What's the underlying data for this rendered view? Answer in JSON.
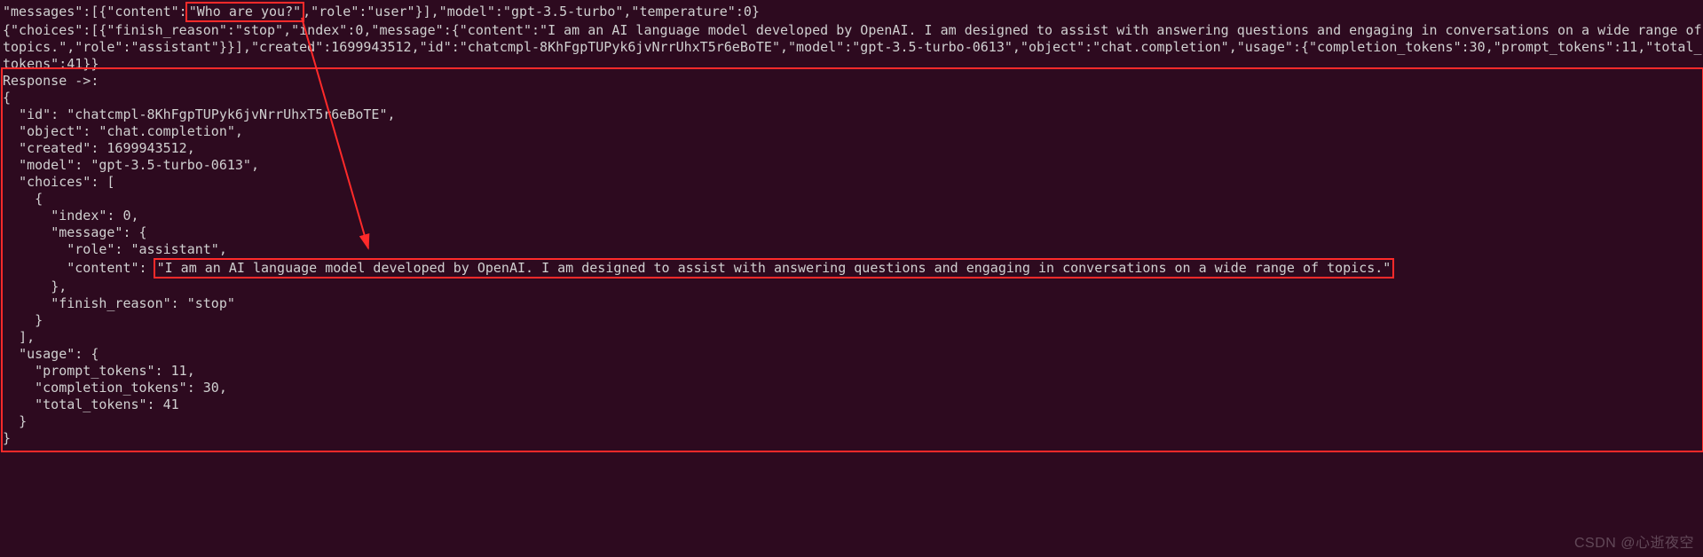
{
  "request_prefix": "\"messages\":[{\"content\":",
  "request_highlight": "\"Who are you?\"",
  "request_suffix": ",\"role\":\"user\"}],\"model\":\"gpt-3.5-turbo\",\"temperature\":0}",
  "raw_choice_line": "{\"choices\":[{\"finish_reason\":\"stop\",\"index\":0,\"message\":{\"content\":\"I am an AI language model developed by OpenAI. I am designed to assist with answering questions and engaging in conversations on a wide range of topics.\",\"role\":\"assistant\"}}],\"created\":1699943512,\"id\":\"chatcmpl-8KhFgpTUPyk6jvNrrUhxT5r6eBoTE\",\"model\":\"gpt-3.5-turbo-0613\",\"object\":\"chat.completion\",\"usage\":{\"completion_tokens\":30,\"prompt_tokens\":11,\"total_tokens\":41}}",
  "response_header": "Response ->:",
  "pretty_open": "{",
  "pretty_id": "  \"id\": \"chatcmpl-8KhFgpTUPyk6jvNrrUhxT5r6eBoTE\",",
  "pretty_object": "  \"object\": \"chat.completion\",",
  "pretty_created": "  \"created\": 1699943512,",
  "pretty_model": "  \"model\": \"gpt-3.5-turbo-0613\",",
  "pretty_choices_k": "  \"choices\": [",
  "pretty_choice_o": "    {",
  "pretty_index": "      \"index\": 0,",
  "pretty_message_k": "      \"message\": {",
  "pretty_role": "        \"role\": \"assistant\",",
  "pretty_content_prefix": "        \"content\": ",
  "pretty_content_value": "\"I am an AI language model developed by OpenAI. I am designed to assist with answering questions and engaging in conversations on a wide range of topics.\"",
  "pretty_message_c": "      },",
  "pretty_finish": "      \"finish_reason\": \"stop\"",
  "pretty_choice_c": "    }",
  "pretty_choices_c": "  ],",
  "pretty_usage_k": "  \"usage\": {",
  "pretty_pt": "    \"prompt_tokens\": 11,",
  "pretty_ct": "    \"completion_tokens\": 30,",
  "pretty_tt": "    \"total_tokens\": 41",
  "pretty_usage_c": "  }",
  "pretty_close": "}",
  "watermark": "CSDN @心逝夜空"
}
